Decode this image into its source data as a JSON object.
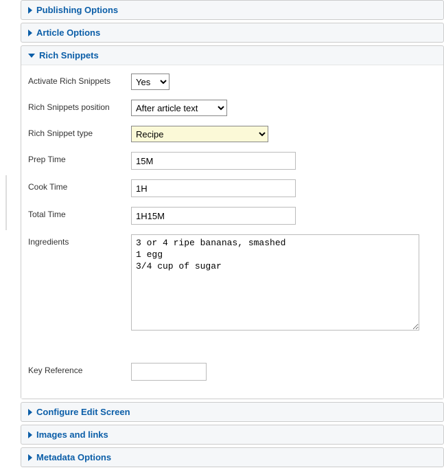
{
  "panels": {
    "publishing": {
      "title": "Publishing Options"
    },
    "article": {
      "title": "Article Options"
    },
    "rich_snippets": {
      "title": "Rich Snippets"
    },
    "configure": {
      "title": "Configure Edit Screen"
    },
    "images": {
      "title": "Images and links"
    },
    "metadata": {
      "title": "Metadata Options"
    }
  },
  "form": {
    "activate": {
      "label": "Activate Rich Snippets",
      "value": "Yes"
    },
    "position": {
      "label": "Rich Snippets position",
      "value": "After article text"
    },
    "type": {
      "label": "Rich Snippet type",
      "value": "Recipe"
    },
    "prep_time": {
      "label": "Prep Time",
      "value": "15M"
    },
    "cook_time": {
      "label": "Cook Time",
      "value": "1H"
    },
    "total_time": {
      "label": "Total Time",
      "value": "1H15M"
    },
    "ingredients": {
      "label": "Ingredients",
      "value": "3 or 4 ripe bananas, smashed\n1 egg\n3/4 cup of sugar"
    },
    "key_ref": {
      "label": "Key Reference",
      "value": ""
    }
  }
}
